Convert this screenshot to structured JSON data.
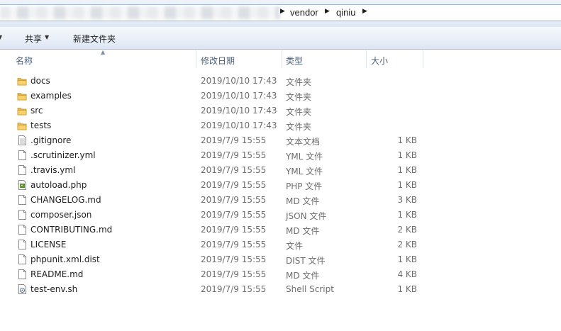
{
  "address": {
    "crumbs": [
      "vendor",
      "qiniu"
    ]
  },
  "toolbar": {
    "share_label": "共享",
    "new_folder_label": "新建文件夹"
  },
  "columns": {
    "name": "名称",
    "modified": "修改日期",
    "type": "类型",
    "size": "大小"
  },
  "files": [
    {
      "name": "docs",
      "modified": "2019/10/10 17:43",
      "type": "文件夹",
      "size": "",
      "icon": "folder-icon"
    },
    {
      "name": "examples",
      "modified": "2019/10/10 17:43",
      "type": "文件夹",
      "size": "",
      "icon": "folder-icon"
    },
    {
      "name": "src",
      "modified": "2019/10/10 17:43",
      "type": "文件夹",
      "size": "",
      "icon": "folder-icon"
    },
    {
      "name": "tests",
      "modified": "2019/10/10 17:43",
      "type": "文件夹",
      "size": "",
      "icon": "folder-icon"
    },
    {
      "name": ".gitignore",
      "modified": "2019/7/9 15:55",
      "type": "文本文档",
      "size": "1 KB",
      "icon": "text-file-icon"
    },
    {
      "name": ".scrutinizer.yml",
      "modified": "2019/7/9 15:55",
      "type": "YML 文件",
      "size": "1 KB",
      "icon": "file-icon"
    },
    {
      "name": ".travis.yml",
      "modified": "2019/7/9 15:55",
      "type": "YML 文件",
      "size": "1 KB",
      "icon": "file-icon"
    },
    {
      "name": "autoload.php",
      "modified": "2019/7/9 15:55",
      "type": "PHP 文件",
      "size": "1 KB",
      "icon": "php-file-icon"
    },
    {
      "name": "CHANGELOG.md",
      "modified": "2019/7/9 15:55",
      "type": "MD 文件",
      "size": "3 KB",
      "icon": "file-icon"
    },
    {
      "name": "composer.json",
      "modified": "2019/7/9 15:55",
      "type": "JSON 文件",
      "size": "1 KB",
      "icon": "file-icon"
    },
    {
      "name": "CONTRIBUTING.md",
      "modified": "2019/7/9 15:55",
      "type": "MD 文件",
      "size": "2 KB",
      "icon": "file-icon"
    },
    {
      "name": "LICENSE",
      "modified": "2019/7/9 15:55",
      "type": "文件",
      "size": "2 KB",
      "icon": "file-icon"
    },
    {
      "name": "phpunit.xml.dist",
      "modified": "2019/7/9 15:55",
      "type": "DIST 文件",
      "size": "1 KB",
      "icon": "file-icon"
    },
    {
      "name": "README.md",
      "modified": "2019/7/9 15:55",
      "type": "MD 文件",
      "size": "4 KB",
      "icon": "file-icon"
    },
    {
      "name": "test-env.sh",
      "modified": "2019/7/9 15:55",
      "type": "Shell Script",
      "size": "1 KB",
      "icon": "shell-script-icon"
    }
  ]
}
